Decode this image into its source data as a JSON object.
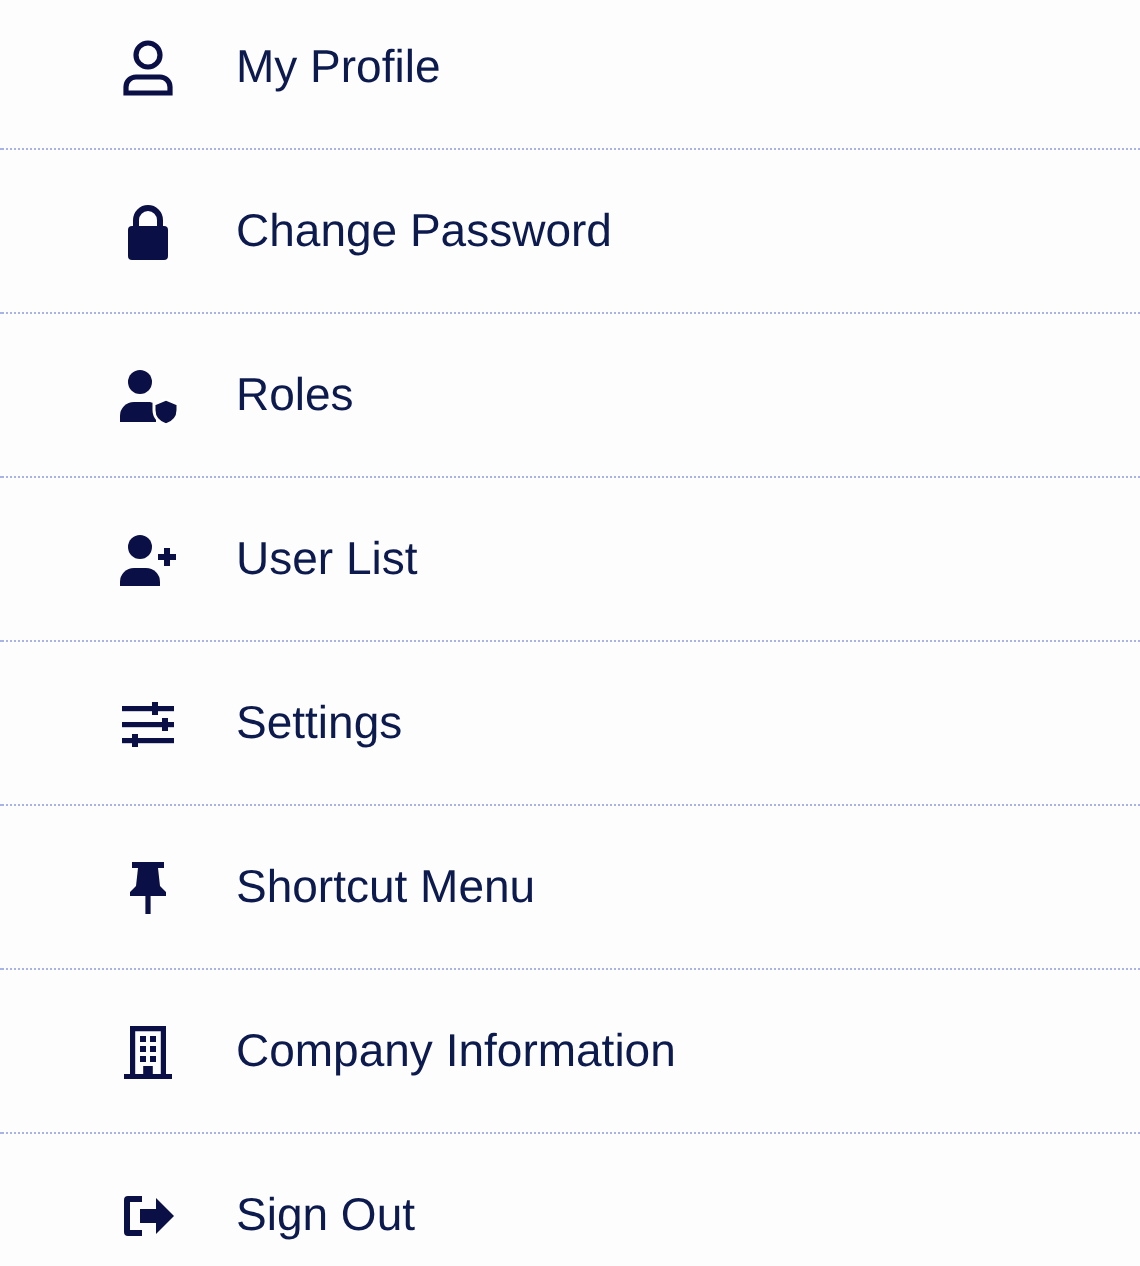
{
  "menu": {
    "items": [
      {
        "kind": "profile",
        "label": "My Profile"
      },
      {
        "kind": "lock",
        "label": "Change Password"
      },
      {
        "kind": "roles",
        "label": "Roles"
      },
      {
        "kind": "user-add",
        "label": "User List"
      },
      {
        "kind": "sliders",
        "label": "Settings"
      },
      {
        "kind": "pin",
        "label": "Shortcut Menu"
      },
      {
        "kind": "building",
        "label": "Company Information"
      },
      {
        "kind": "signout",
        "label": "Sign Out"
      }
    ]
  }
}
